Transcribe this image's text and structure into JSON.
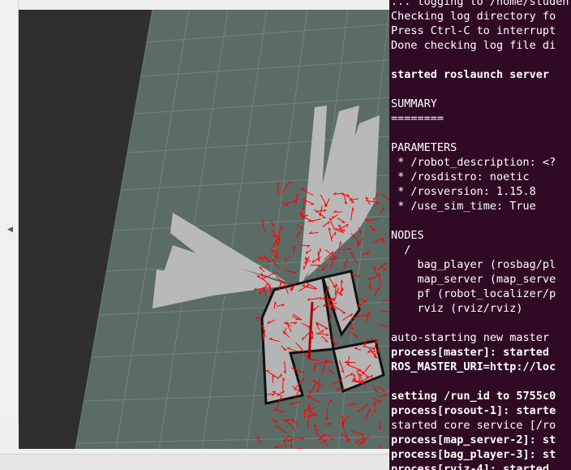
{
  "rviz": {
    "panel_toggle_icon": "chevron-left-icon",
    "viewport": {
      "grid_color": "#5a6b66",
      "map_occupied_color": "#111111",
      "map_free_color": "#b7b7b7",
      "pose_array_color": "#ff0000",
      "background_color": "#2f2f2f"
    }
  },
  "terminal": {
    "background_color": "#300a24",
    "lines": [
      {
        "text": "... logging to /home/student/.ros/log",
        "bold": false
      },
      {
        "text": "Checking log directory fo",
        "bold": false
      },
      {
        "text": "Press Ctrl-C to interrupt",
        "bold": false
      },
      {
        "text": "Done checking log file di",
        "bold": false
      },
      {
        "text": "",
        "bold": false
      },
      {
        "text": "started roslaunch server",
        "bold": true
      },
      {
        "text": "",
        "bold": false
      },
      {
        "text": "SUMMARY",
        "bold": false
      },
      {
        "text": "========",
        "bold": false
      },
      {
        "text": "",
        "bold": false
      },
      {
        "text": "PARAMETERS",
        "bold": false
      },
      {
        "text": " * /robot_description: <?",
        "bold": false
      },
      {
        "text": " * /rosdistro: noetic",
        "bold": false
      },
      {
        "text": " * /rosversion: 1.15.8",
        "bold": false
      },
      {
        "text": " * /use_sim_time: True",
        "bold": false
      },
      {
        "text": "",
        "bold": false
      },
      {
        "text": "NODES",
        "bold": false
      },
      {
        "text": "  /",
        "bold": false
      },
      {
        "text": "    bag_player (rosbag/pl",
        "bold": false
      },
      {
        "text": "    map_server (map_serve",
        "bold": false
      },
      {
        "text": "    pf (robot_localizer/p",
        "bold": false
      },
      {
        "text": "    rviz (rviz/rviz)",
        "bold": false
      },
      {
        "text": "",
        "bold": false
      },
      {
        "text": "auto-starting new master",
        "bold": false
      },
      {
        "text": "process[master]: started",
        "bold": true
      },
      {
        "text": "ROS_MASTER_URI=http://loc",
        "bold": true
      },
      {
        "text": "",
        "bold": false
      },
      {
        "text": "setting /run_id to 5755c0",
        "bold": true
      },
      {
        "text": "process[rosout-1]: starte",
        "bold": true
      },
      {
        "text": "started core service [/ro",
        "bold": false
      },
      {
        "text": "process[map_server-2]: st",
        "bold": true
      },
      {
        "text": "process[bag_player-3]: st",
        "bold": true
      },
      {
        "text": "process[rviz-4]: started",
        "bold": true
      }
    ]
  }
}
